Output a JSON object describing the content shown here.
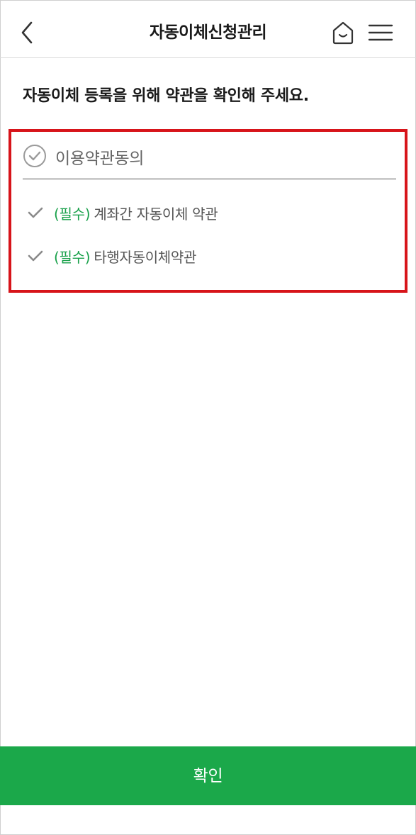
{
  "header": {
    "title": "자동이체신청관리",
    "back_icon": "chevron-left-icon",
    "home_icon": "home-icon",
    "menu_icon": "hamburger-menu-icon"
  },
  "instruction": "자동이체 등록을 위해 약관을 확인해 주세요.",
  "terms": {
    "agree_all_label": "이용약관동의",
    "items": [
      {
        "required_tag": "(필수)",
        "name": "계좌간 자동이체 약관"
      },
      {
        "required_tag": "(필수)",
        "name": "타행자동이체약관"
      }
    ]
  },
  "confirm_label": "확인",
  "colors": {
    "accent_green": "#1ba84a",
    "required_green": "#1aa14b",
    "highlight_red": "#d7141a"
  }
}
